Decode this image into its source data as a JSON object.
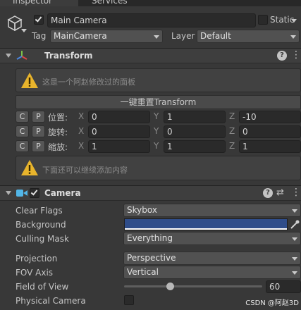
{
  "tabs": {
    "inspector": "Inspector",
    "services": "Services"
  },
  "gameobject": {
    "active": true,
    "name": "Main Camera",
    "static_label": "Static",
    "static_checked": false,
    "tag_label": "Tag",
    "tag_value": "MainCamera",
    "layer_label": "Layer",
    "layer_value": "Default"
  },
  "transform": {
    "title": "Transform",
    "note": "这是一个阿赵修改过的面板",
    "reset_button": "一键重置Transform",
    "copy_label": "C",
    "paste_label": "P",
    "axes": {
      "x": "X",
      "y": "Y",
      "z": "Z"
    },
    "rows": [
      {
        "label": "位置:",
        "x": "0",
        "y": "1",
        "z": "-10"
      },
      {
        "label": "旋转:",
        "x": "0",
        "y": "0",
        "z": "0"
      },
      {
        "label": "缩放:",
        "x": "1",
        "y": "1",
        "z": "1"
      }
    ],
    "note2": "下面还可以继续添加内容"
  },
  "camera": {
    "title": "Camera",
    "enabled": true,
    "clear_flags_label": "Clear Flags",
    "clear_flags_value": "Skybox",
    "background_label": "Background",
    "background_color": "#2f4d8a",
    "culling_mask_label": "Culling Mask",
    "culling_mask_value": "Everything",
    "projection_label": "Projection",
    "projection_value": "Perspective",
    "fov_axis_label": "FOV Axis",
    "fov_axis_value": "Vertical",
    "fov_label": "Field of View",
    "fov_value": "60",
    "fov_fraction": 0.33,
    "physical_camera_label": "Physical Camera",
    "physical_camera_checked": false
  },
  "watermark": "CSDN @阿赵3D",
  "colors": {
    "accent_check": "#e0e0e0",
    "warning": "#e8b42c",
    "camera_icon": "#52b6e8"
  }
}
